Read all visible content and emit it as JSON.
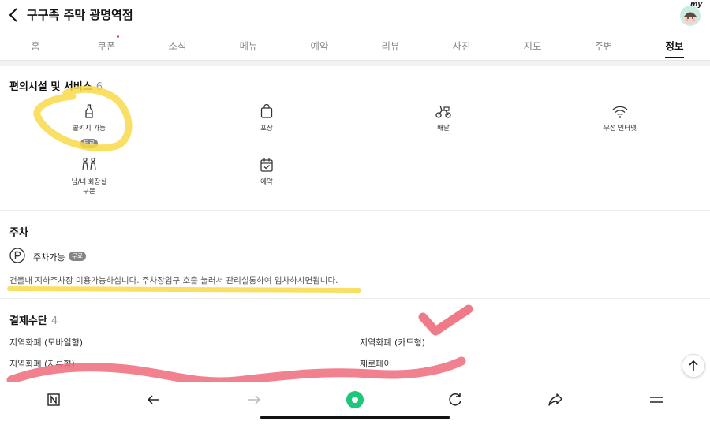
{
  "header": {
    "title": "구구족 주막 광명역점",
    "avatar_tag": "my"
  },
  "tabs": [
    {
      "label": "홈"
    },
    {
      "label": "쿠폰"
    },
    {
      "label": "소식"
    },
    {
      "label": "메뉴"
    },
    {
      "label": "예약"
    },
    {
      "label": "리뷰"
    },
    {
      "label": "사진"
    },
    {
      "label": "지도"
    },
    {
      "label": "주변"
    },
    {
      "label": "정보"
    }
  ],
  "active_tab": "정보",
  "facilities": {
    "title": "편의시설 및 서비스",
    "count": "6",
    "items": [
      {
        "label": "콜키지 가능",
        "badge": "무료",
        "icon": "wine-bottle-icon"
      },
      {
        "label": "포장",
        "icon": "shopping-bag-icon"
      },
      {
        "label": "배달",
        "icon": "scooter-icon"
      },
      {
        "label": "무선 인터넷",
        "icon": "wifi-icon"
      },
      {
        "label": "남/녀 화장실",
        "label2": "구분",
        "icon": "restroom-icon"
      },
      {
        "label": "예약",
        "icon": "calendar-check-icon"
      }
    ]
  },
  "parking": {
    "title": "주차",
    "label": "주차가능",
    "badge": "무료",
    "note": "건물내 지하주차장 이용가능하십니다. 주차장입구 호출 눌러서 관리실통하여 입차하시면됩니다."
  },
  "payment": {
    "title": "결제수단",
    "count": "4",
    "methods": [
      "지역화폐 (모바일형)",
      "지역화폐 (카드형)",
      "지역화폐 (지류형)",
      "제로페이"
    ]
  },
  "colors": {
    "highlight_yellow": "#f9d94a",
    "highlight_pink": "#f06b7c",
    "accent_green": "#1ec800"
  },
  "bottom_nav": [
    "naver-home-icon",
    "back-arrow-icon",
    "forward-arrow-icon",
    "green-dot-icon",
    "refresh-icon",
    "share-icon",
    "menu-icon"
  ]
}
